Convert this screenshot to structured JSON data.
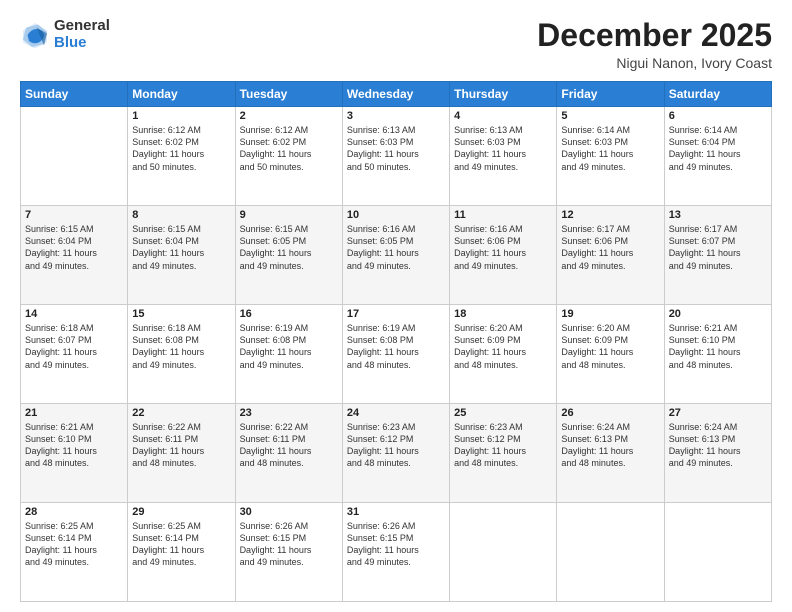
{
  "logo": {
    "general": "General",
    "blue": "Blue"
  },
  "header": {
    "title": "December 2025",
    "subtitle": "Nigui Nanon, Ivory Coast"
  },
  "weekdays": [
    "Sunday",
    "Monday",
    "Tuesday",
    "Wednesday",
    "Thursday",
    "Friday",
    "Saturday"
  ],
  "weeks": [
    [
      {
        "day": "",
        "info": ""
      },
      {
        "day": "1",
        "info": "Sunrise: 6:12 AM\nSunset: 6:02 PM\nDaylight: 11 hours\nand 50 minutes."
      },
      {
        "day": "2",
        "info": "Sunrise: 6:12 AM\nSunset: 6:02 PM\nDaylight: 11 hours\nand 50 minutes."
      },
      {
        "day": "3",
        "info": "Sunrise: 6:13 AM\nSunset: 6:03 PM\nDaylight: 11 hours\nand 50 minutes."
      },
      {
        "day": "4",
        "info": "Sunrise: 6:13 AM\nSunset: 6:03 PM\nDaylight: 11 hours\nand 49 minutes."
      },
      {
        "day": "5",
        "info": "Sunrise: 6:14 AM\nSunset: 6:03 PM\nDaylight: 11 hours\nand 49 minutes."
      },
      {
        "day": "6",
        "info": "Sunrise: 6:14 AM\nSunset: 6:04 PM\nDaylight: 11 hours\nand 49 minutes."
      }
    ],
    [
      {
        "day": "7",
        "info": "Sunrise: 6:15 AM\nSunset: 6:04 PM\nDaylight: 11 hours\nand 49 minutes."
      },
      {
        "day": "8",
        "info": "Sunrise: 6:15 AM\nSunset: 6:04 PM\nDaylight: 11 hours\nand 49 minutes."
      },
      {
        "day": "9",
        "info": "Sunrise: 6:15 AM\nSunset: 6:05 PM\nDaylight: 11 hours\nand 49 minutes."
      },
      {
        "day": "10",
        "info": "Sunrise: 6:16 AM\nSunset: 6:05 PM\nDaylight: 11 hours\nand 49 minutes."
      },
      {
        "day": "11",
        "info": "Sunrise: 6:16 AM\nSunset: 6:06 PM\nDaylight: 11 hours\nand 49 minutes."
      },
      {
        "day": "12",
        "info": "Sunrise: 6:17 AM\nSunset: 6:06 PM\nDaylight: 11 hours\nand 49 minutes."
      },
      {
        "day": "13",
        "info": "Sunrise: 6:17 AM\nSunset: 6:07 PM\nDaylight: 11 hours\nand 49 minutes."
      }
    ],
    [
      {
        "day": "14",
        "info": "Sunrise: 6:18 AM\nSunset: 6:07 PM\nDaylight: 11 hours\nand 49 minutes."
      },
      {
        "day": "15",
        "info": "Sunrise: 6:18 AM\nSunset: 6:08 PM\nDaylight: 11 hours\nand 49 minutes."
      },
      {
        "day": "16",
        "info": "Sunrise: 6:19 AM\nSunset: 6:08 PM\nDaylight: 11 hours\nand 49 minutes."
      },
      {
        "day": "17",
        "info": "Sunrise: 6:19 AM\nSunset: 6:08 PM\nDaylight: 11 hours\nand 48 minutes."
      },
      {
        "day": "18",
        "info": "Sunrise: 6:20 AM\nSunset: 6:09 PM\nDaylight: 11 hours\nand 48 minutes."
      },
      {
        "day": "19",
        "info": "Sunrise: 6:20 AM\nSunset: 6:09 PM\nDaylight: 11 hours\nand 48 minutes."
      },
      {
        "day": "20",
        "info": "Sunrise: 6:21 AM\nSunset: 6:10 PM\nDaylight: 11 hours\nand 48 minutes."
      }
    ],
    [
      {
        "day": "21",
        "info": "Sunrise: 6:21 AM\nSunset: 6:10 PM\nDaylight: 11 hours\nand 48 minutes."
      },
      {
        "day": "22",
        "info": "Sunrise: 6:22 AM\nSunset: 6:11 PM\nDaylight: 11 hours\nand 48 minutes."
      },
      {
        "day": "23",
        "info": "Sunrise: 6:22 AM\nSunset: 6:11 PM\nDaylight: 11 hours\nand 48 minutes."
      },
      {
        "day": "24",
        "info": "Sunrise: 6:23 AM\nSunset: 6:12 PM\nDaylight: 11 hours\nand 48 minutes."
      },
      {
        "day": "25",
        "info": "Sunrise: 6:23 AM\nSunset: 6:12 PM\nDaylight: 11 hours\nand 48 minutes."
      },
      {
        "day": "26",
        "info": "Sunrise: 6:24 AM\nSunset: 6:13 PM\nDaylight: 11 hours\nand 48 minutes."
      },
      {
        "day": "27",
        "info": "Sunrise: 6:24 AM\nSunset: 6:13 PM\nDaylight: 11 hours\nand 49 minutes."
      }
    ],
    [
      {
        "day": "28",
        "info": "Sunrise: 6:25 AM\nSunset: 6:14 PM\nDaylight: 11 hours\nand 49 minutes."
      },
      {
        "day": "29",
        "info": "Sunrise: 6:25 AM\nSunset: 6:14 PM\nDaylight: 11 hours\nand 49 minutes."
      },
      {
        "day": "30",
        "info": "Sunrise: 6:26 AM\nSunset: 6:15 PM\nDaylight: 11 hours\nand 49 minutes."
      },
      {
        "day": "31",
        "info": "Sunrise: 6:26 AM\nSunset: 6:15 PM\nDaylight: 11 hours\nand 49 minutes."
      },
      {
        "day": "",
        "info": ""
      },
      {
        "day": "",
        "info": ""
      },
      {
        "day": "",
        "info": ""
      }
    ]
  ]
}
